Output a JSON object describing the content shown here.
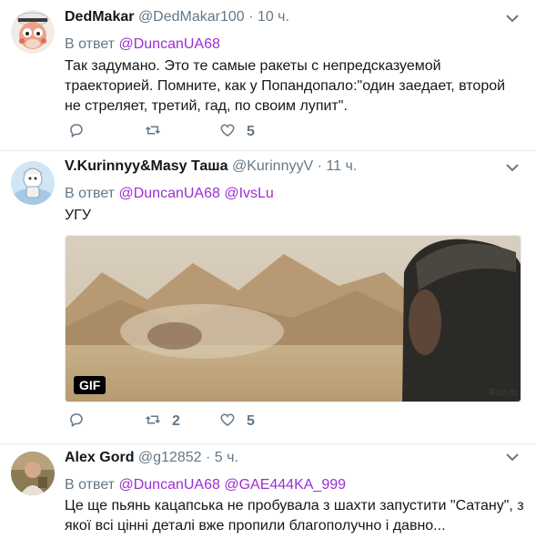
{
  "tweets": [
    {
      "name": "DedMakar",
      "handle": "@DedMakar100",
      "time": "10 ч.",
      "reply_prefix": "В ответ",
      "mentions": [
        "@DuncanUA68"
      ],
      "text": "Так задумано. Это те самые ракеты с непредсказуемой траекторией. Помните, как у Попандопало:\"один заедает, второй не стреляет, третий, гад, по своим лупит\".",
      "reply_count": "",
      "retweet_count": "",
      "like_count": "5"
    },
    {
      "name": "V.Kurinnyy&Masy Таша",
      "handle": "@KurinnyyV",
      "time": "11 ч.",
      "reply_prefix": "В ответ",
      "mentions": [
        "@DuncanUA68",
        "@IvsLu"
      ],
      "text": "УГУ",
      "media": {
        "badge": "GIF",
        "watermark": "iFun.ru"
      },
      "reply_count": "",
      "retweet_count": "2",
      "like_count": "5"
    },
    {
      "name": "Alex Gord",
      "handle": "@g12852",
      "time": "5 ч.",
      "reply_prefix": "В ответ",
      "mentions": [
        "@DuncanUA68",
        "@GAE444KA_999"
      ],
      "text": "Це ще пьянь кацапська не пробувала з шахти запустити \"Сатану\", з якої всі цінні деталі вже пропили благополучно і давно..."
    }
  ],
  "separator": "·",
  "colors": {
    "mention": "#9b2fd1",
    "secondary": "#657786",
    "text": "#14171a",
    "border": "#e6ecf0"
  },
  "icons": [
    "reply-icon",
    "retweet-icon",
    "like-icon",
    "caret-down-icon"
  ]
}
